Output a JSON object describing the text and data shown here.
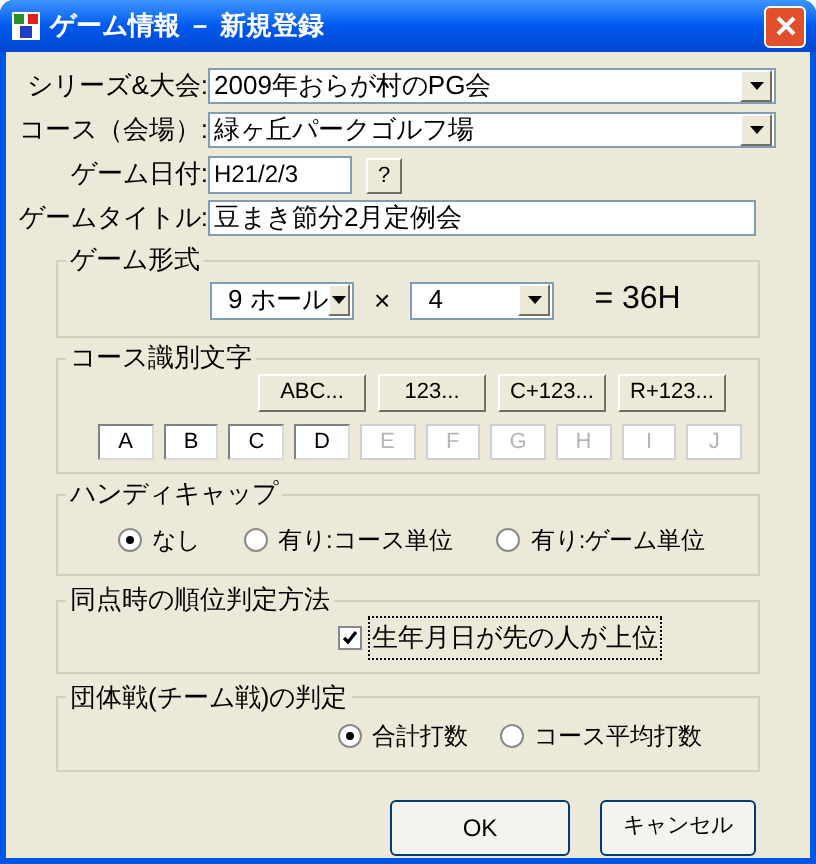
{
  "window": {
    "title": "ゲーム情報 － 新規登録"
  },
  "fields": [
    {
      "label": "シリーズ&大会:",
      "value": "2009年おらが村のPG会",
      "kind": "dropdown"
    },
    {
      "label": "コース（会場）:",
      "value": "緑ヶ丘パークゴルフ場",
      "kind": "dropdown"
    },
    {
      "label": "ゲーム日付:",
      "value": "H21/2/3",
      "kind": "date",
      "button": "?"
    },
    {
      "label": "ゲームタイトル:",
      "value": "豆まき節分2月定例会",
      "kind": "text"
    }
  ],
  "game_format": {
    "title": "ゲーム形式",
    "holes": "9 ホール",
    "times_sign": "×",
    "count": "4",
    "result": "= 36H"
  },
  "course_letters": {
    "title": "コース識別文字",
    "buttons": [
      "ABC...",
      "123...",
      "C+123...",
      "R+123..."
    ],
    "letters": [
      {
        "text": "A",
        "disabled": false
      },
      {
        "text": "B",
        "disabled": false
      },
      {
        "text": "C",
        "disabled": false
      },
      {
        "text": "D",
        "disabled": false
      },
      {
        "text": "E",
        "disabled": true
      },
      {
        "text": "F",
        "disabled": true
      },
      {
        "text": "G",
        "disabled": true
      },
      {
        "text": "H",
        "disabled": true
      },
      {
        "text": "I",
        "disabled": true
      },
      {
        "text": "J",
        "disabled": true
      }
    ]
  },
  "handicap": {
    "title": "ハンディキャップ",
    "options": [
      {
        "label": "なし",
        "selected": true
      },
      {
        "label": "有り:コース単位",
        "selected": false
      },
      {
        "label": "有り:ゲーム単位",
        "selected": false
      }
    ]
  },
  "tie_break": {
    "title": "同点時の順位判定方法",
    "option": {
      "label": "生年月日が先の人が上位",
      "checked": true
    }
  },
  "team": {
    "title": "団体戦(チーム戦)の判定",
    "options": [
      {
        "label": "合計打数",
        "selected": true
      },
      {
        "label": "コース平均打数",
        "selected": false
      }
    ]
  },
  "buttons": [
    "OK",
    "キャンセル"
  ]
}
